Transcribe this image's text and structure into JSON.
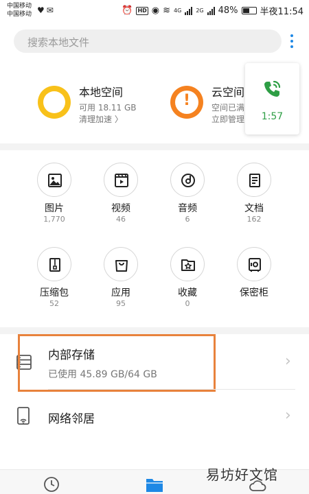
{
  "status_bar": {
    "carrier_1": "中国移动",
    "carrier_2": "中国移动",
    "network_4g": "4G",
    "network_2g": "2G",
    "battery": "48%",
    "time": "半夜11:54",
    "battery_level": 0.48
  },
  "search": {
    "placeholder": "搜索本地文件"
  },
  "storage": {
    "local": {
      "title": "本地空间",
      "available": "可用 18.11 GB",
      "action": "清理加速 〉"
    },
    "cloud": {
      "title": "云空间",
      "status": "空间已满",
      "action": "立即管理"
    }
  },
  "call": {
    "duration": "1:57"
  },
  "categories": [
    {
      "label": "图片",
      "count": "1,770",
      "icon": "image-icon"
    },
    {
      "label": "视频",
      "count": "46",
      "icon": "video-icon"
    },
    {
      "label": "音频",
      "count": "6",
      "icon": "audio-icon"
    },
    {
      "label": "文档",
      "count": "162",
      "icon": "document-icon"
    },
    {
      "label": "压缩包",
      "count": "52",
      "icon": "archive-icon"
    },
    {
      "label": "应用",
      "count": "95",
      "icon": "app-bag-icon"
    },
    {
      "label": "收藏",
      "count": "0",
      "icon": "star-folder-icon"
    },
    {
      "label": "保密柜",
      "count": "",
      "icon": "safe-icon"
    }
  ],
  "locations": {
    "internal": {
      "title": "内部存储",
      "usage": "已使用 45.89 GB/64 GB"
    },
    "network": {
      "title": "网络邻居"
    }
  },
  "watermark": "易坊好文馆",
  "colors": {
    "accent": "#1e88e5",
    "ring_local": "#f8c11a",
    "ring_cloud": "#f58220",
    "call_green": "#2e9e45",
    "highlight": "#e8823c"
  }
}
